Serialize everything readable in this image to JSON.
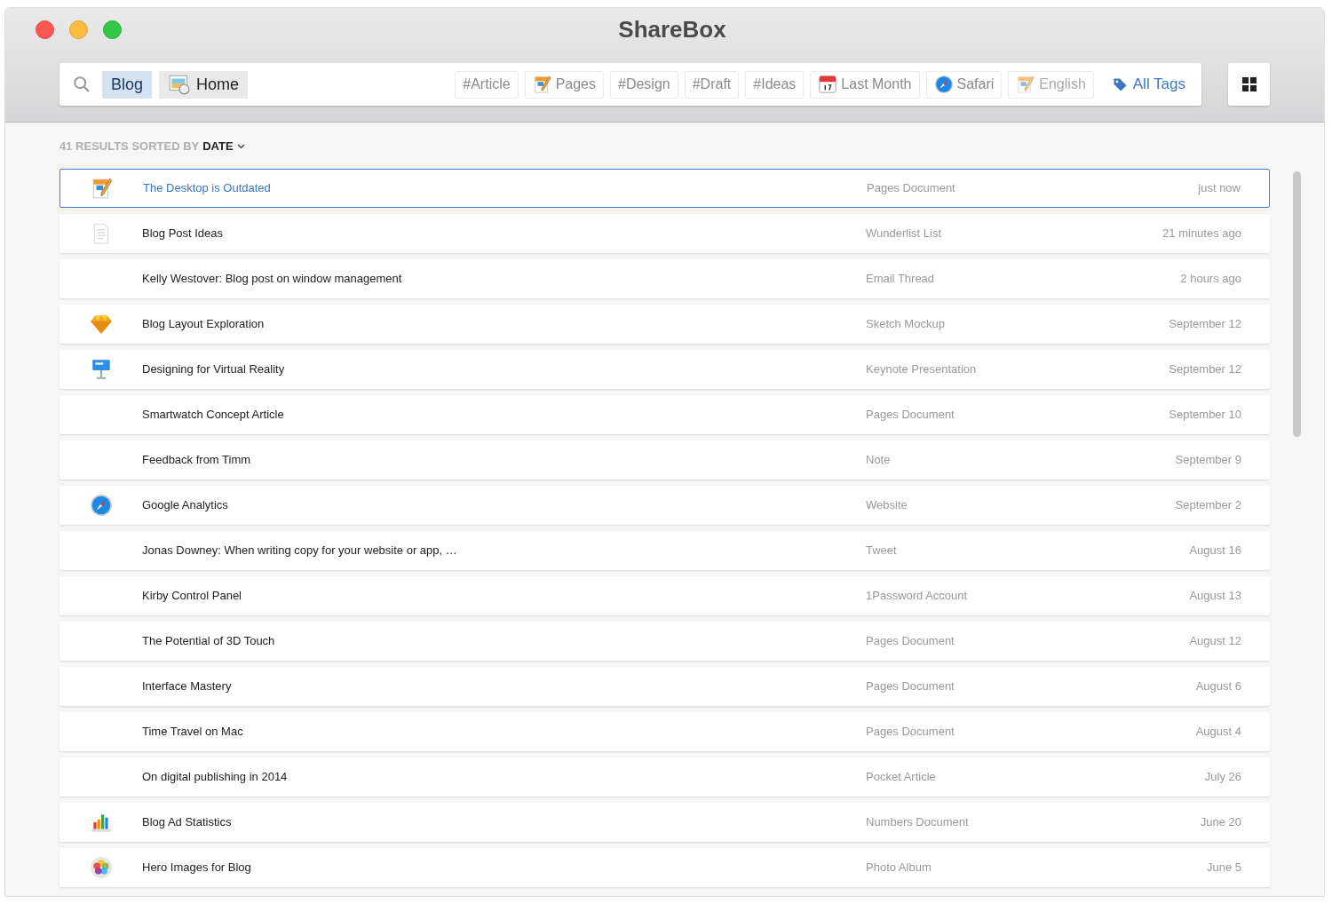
{
  "window": {
    "title": "ShareBox"
  },
  "search": {
    "tokens": [
      {
        "label": "Blog",
        "kind": "text",
        "selected": true
      },
      {
        "label": "Home",
        "kind": "preview",
        "selected": false
      }
    ]
  },
  "tags": [
    {
      "label": "#Article",
      "kind": "plain"
    },
    {
      "label": "Pages",
      "kind": "pages"
    },
    {
      "label": "#Design",
      "kind": "plain"
    },
    {
      "label": "#Draft",
      "kind": "plain"
    },
    {
      "label": "#Ideas",
      "kind": "plain"
    },
    {
      "label": "Last Month",
      "kind": "calendar"
    },
    {
      "label": "Safari",
      "kind": "safari"
    },
    {
      "label": "English",
      "kind": "pages-faded"
    }
  ],
  "all_tags": {
    "label": "All Tags"
  },
  "results": {
    "count_label": "41 RESULTS SORTED BY",
    "sort": "DATE"
  },
  "rows": [
    {
      "title": "The Desktop is Outdated",
      "type": "Pages Document",
      "date": "just now",
      "kind": "pages",
      "selected": true
    },
    {
      "title": "Blog Post Ideas",
      "type": "Wunderlist List",
      "date": "21 minutes ago",
      "kind": "text",
      "selected": false
    },
    {
      "title": "Kelly Westover: Blog post on window management",
      "type": "Email Thread",
      "date": "2 hours ago",
      "kind": "none",
      "selected": false
    },
    {
      "title": "Blog Layout Exploration",
      "type": "Sketch Mockup",
      "date": "September 12",
      "kind": "sketch",
      "selected": false
    },
    {
      "title": "Designing for Virtual Reality",
      "type": "Keynote Presentation",
      "date": "September 12",
      "kind": "keynote",
      "selected": false
    },
    {
      "title": "Smartwatch Concept Article",
      "type": "Pages Document",
      "date": "September 10",
      "kind": "none",
      "selected": false
    },
    {
      "title": "Feedback from Timm",
      "type": "Note",
      "date": "September 9",
      "kind": "none",
      "selected": false
    },
    {
      "title": "Google Analytics",
      "type": "Website",
      "date": "September 2",
      "kind": "safari",
      "selected": false
    },
    {
      "title": "Jonas Downey: When writing copy for your website or app, …",
      "type": "Tweet",
      "date": "August 16",
      "kind": "none",
      "selected": false
    },
    {
      "title": "Kirby Control Panel",
      "type": "1Password Account",
      "date": "August 13",
      "kind": "none",
      "selected": false
    },
    {
      "title": "The Potential of 3D Touch",
      "type": "Pages Document",
      "date": "August 12",
      "kind": "none",
      "selected": false
    },
    {
      "title": "Interface Mastery",
      "type": "Pages Document",
      "date": "August 6",
      "kind": "none",
      "selected": false
    },
    {
      "title": "Time Travel on Mac",
      "type": "Pages Document",
      "date": "August 4",
      "kind": "none",
      "selected": false
    },
    {
      "title": "On digital publishing in 2014",
      "type": "Pocket Article",
      "date": "July 26",
      "kind": "none",
      "selected": false
    },
    {
      "title": "Blog Ad Statistics",
      "type": "Numbers Document",
      "date": "June 20",
      "kind": "numbers",
      "selected": false
    },
    {
      "title": "Hero Images for Blog",
      "type": "Photo Album",
      "date": "June 5",
      "kind": "photos",
      "selected": false
    }
  ]
}
